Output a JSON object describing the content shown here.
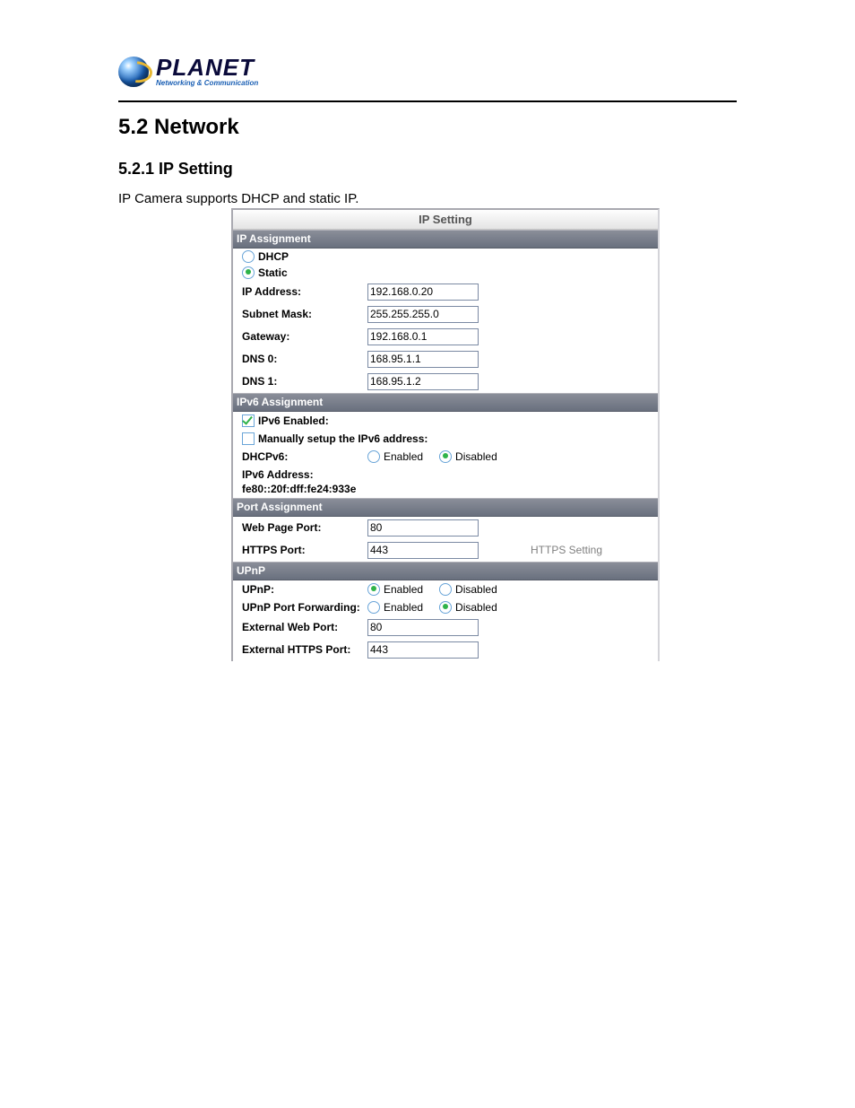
{
  "logo": {
    "brand": "PLANET",
    "tagline": "Networking & Communication"
  },
  "headings": {
    "section": "5.2 Network",
    "subsection": "5.2.1 IP Setting"
  },
  "intro": "IP Camera supports DHCP and static IP.",
  "panel": {
    "title": "IP Setting",
    "ip_assignment": {
      "header": "IP Assignment",
      "dhcp_label": "DHCP",
      "static_label": "Static",
      "selected": "static",
      "ip_address_label": "IP Address:",
      "ip_address_value": "192.168.0.20",
      "subnet_mask_label": "Subnet Mask:",
      "subnet_mask_value": "255.255.255.0",
      "gateway_label": "Gateway:",
      "gateway_value": "192.168.0.1",
      "dns0_label": "DNS 0:",
      "dns0_value": "168.95.1.1",
      "dns1_label": "DNS 1:",
      "dns1_value": "168.95.1.2"
    },
    "ipv6_assignment": {
      "header": "IPv6 Assignment",
      "ipv6_enabled_label": "IPv6 Enabled:",
      "ipv6_enabled_checked": true,
      "manual_label": "Manually setup the IPv6 address:",
      "manual_checked": false,
      "dhcpv6_label": "DHCPv6:",
      "dhcpv6_enabled_label": "Enabled",
      "dhcpv6_disabled_label": "Disabled",
      "dhcpv6_value": "disabled",
      "ipv6_address_label": "IPv6 Address:",
      "ipv6_address_value": "fe80::20f:dff:fe24:933e"
    },
    "port_assignment": {
      "header": "Port Assignment",
      "web_port_label": "Web Page Port:",
      "web_port_value": "80",
      "https_port_label": "HTTPS Port:",
      "https_port_value": "443",
      "https_setting_link": "HTTPS Setting"
    },
    "upnp": {
      "header": "UPnP",
      "upnp_label": "UPnP:",
      "upnp_enabled_label": "Enabled",
      "upnp_disabled_label": "Disabled",
      "upnp_value": "enabled",
      "upnp_pf_label": "UPnP Port Forwarding:",
      "upnp_pf_enabled_label": "Enabled",
      "upnp_pf_disabled_label": "Disabled",
      "upnp_pf_value": "disabled",
      "ext_web_label": "External Web Port:",
      "ext_web_value": "80",
      "ext_https_label": "External HTTPS Port:",
      "ext_https_value": "443"
    }
  }
}
